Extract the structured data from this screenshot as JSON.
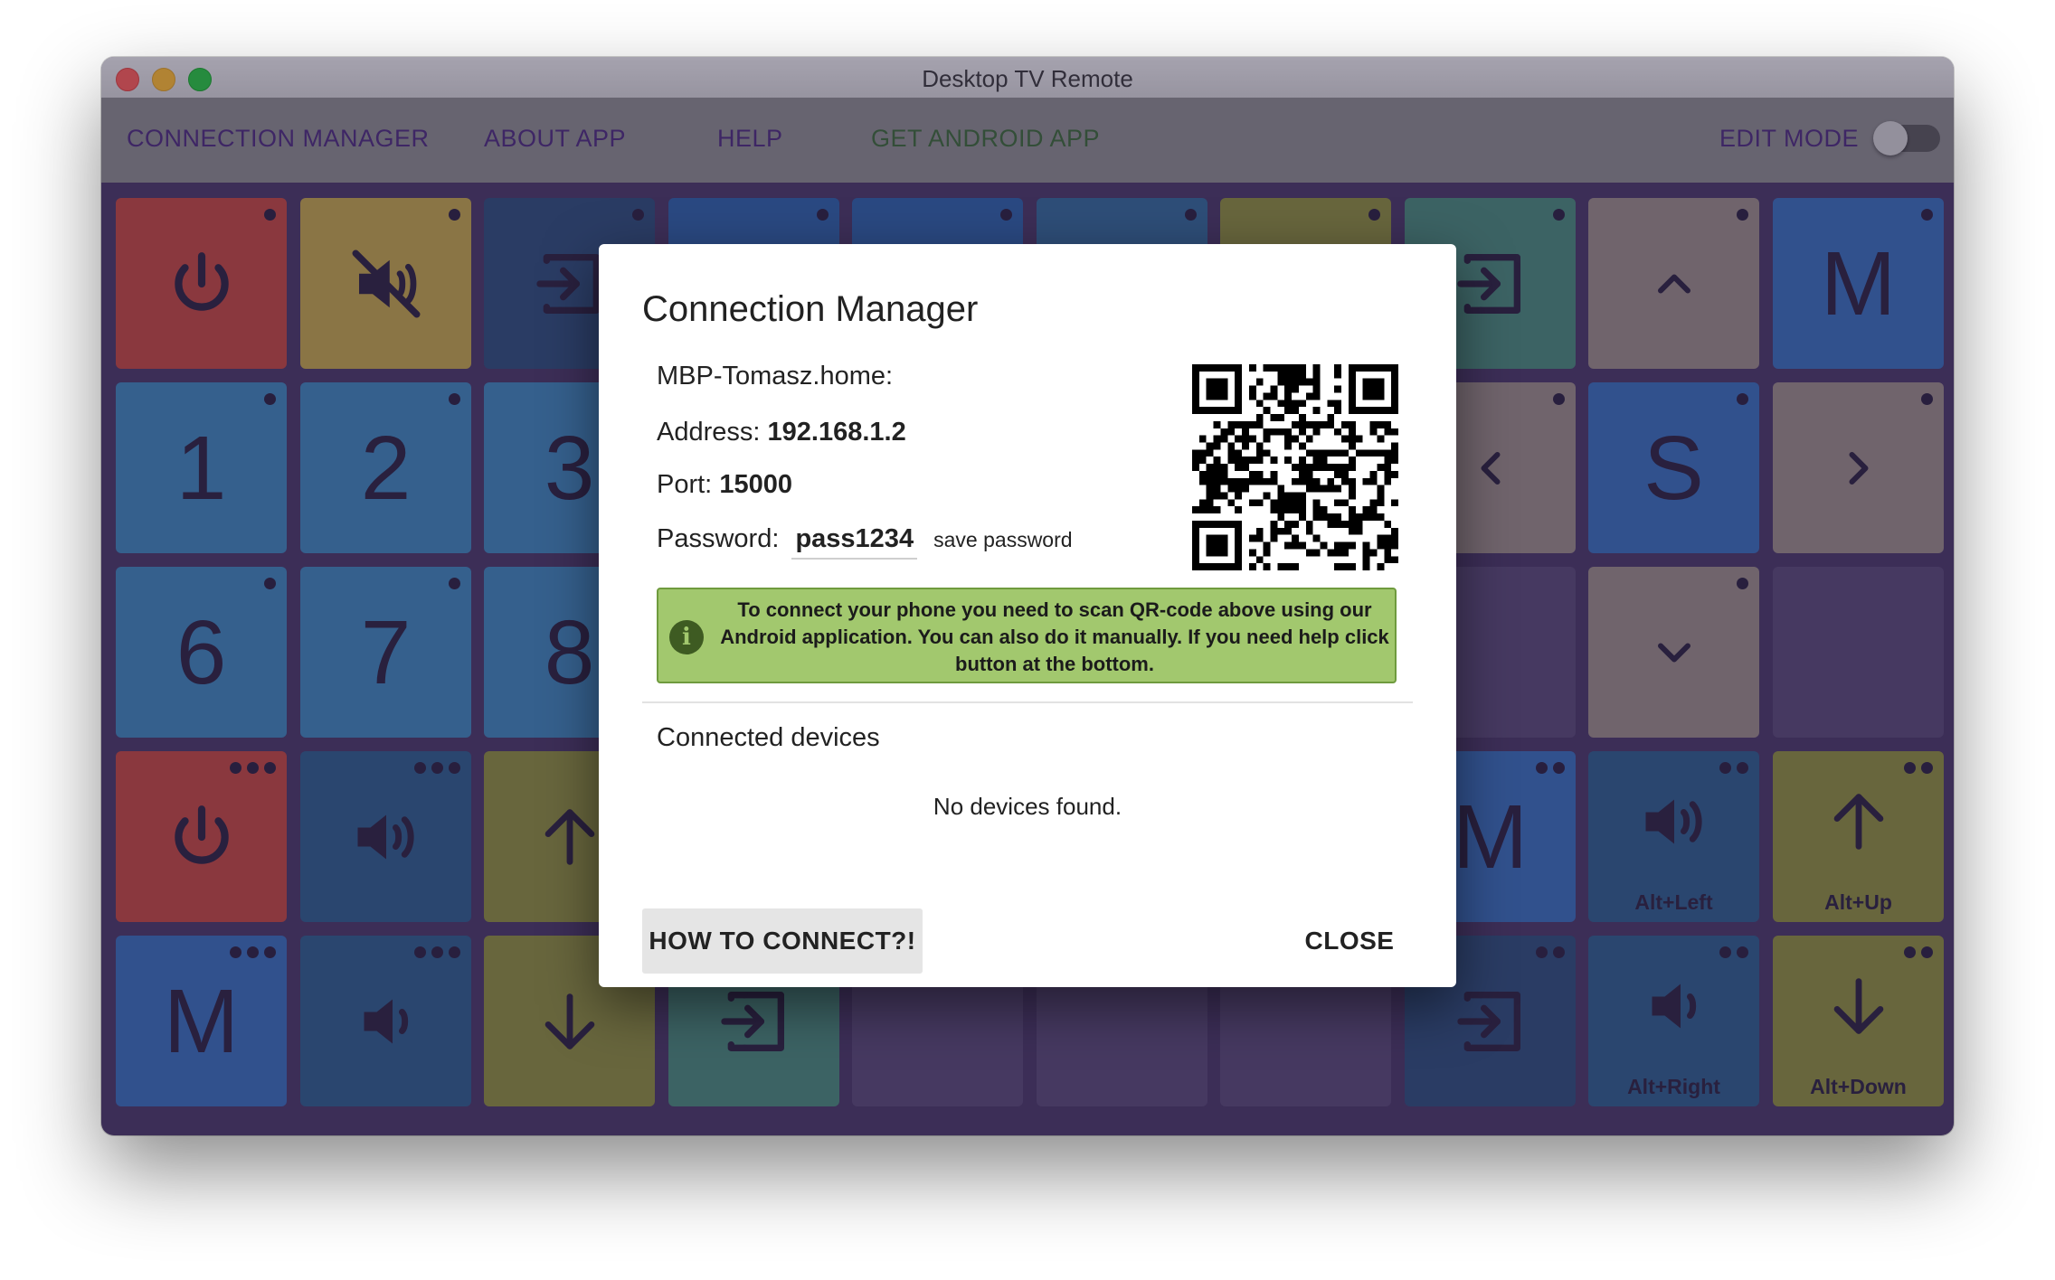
{
  "window": {
    "title": "Desktop TV Remote"
  },
  "nav": {
    "connection_manager": "CONNECTION MANAGER",
    "about_app": "ABOUT APP",
    "help": "HELP",
    "get_android_app": "GET ANDROID APP",
    "edit_mode": "EDIT MODE",
    "edit_mode_on": false
  },
  "colors": {
    "background_grid": "#4a3a66",
    "appbar": "#8c8c8c",
    "nav_purple": "#4d2d7c",
    "nav_green": "#3c6a36",
    "alert_green": "#a2c86e"
  },
  "tiles": [
    {
      "row": 0,
      "col": 0,
      "color": "#c2493f",
      "icon": "power-icon",
      "label": "",
      "caption": "",
      "dots": 1
    },
    {
      "row": 0,
      "col": 1,
      "color": "#c2a64a",
      "icon": "mute-icon",
      "label": "",
      "caption": "",
      "dots": 1
    },
    {
      "row": 0,
      "col": 2,
      "color": "#2f4f7a",
      "icon": "input-icon",
      "label": "",
      "caption": "",
      "dots": 1
    },
    {
      "row": 0,
      "col": 3,
      "color": "#2f63a8",
      "icon": "",
      "label": "",
      "caption": "",
      "dots": 1
    },
    {
      "row": 0,
      "col": 4,
      "color": "#2f63a8",
      "icon": "",
      "label": "",
      "caption": "",
      "dots": 1
    },
    {
      "row": 0,
      "col": 5,
      "color": "#356a99",
      "icon": "",
      "label": "",
      "caption": "",
      "dots": 1
    },
    {
      "row": 0,
      "col": 6,
      "color": "#8e8f3e",
      "icon": "",
      "label": "",
      "caption": "",
      "dots": 1
    },
    {
      "row": 0,
      "col": 7,
      "color": "#4a8a7a",
      "icon": "input-icon",
      "label": "",
      "caption": "",
      "dots": 1
    },
    {
      "row": 0,
      "col": 8,
      "color": "#9a8d86",
      "icon": "chevron-up-icon",
      "label": "",
      "caption": "",
      "dots": 1
    },
    {
      "row": 0,
      "col": 9,
      "color": "#3a6fb8",
      "icon": "",
      "label": "M",
      "caption": "",
      "dots": 1
    },
    {
      "row": 1,
      "col": 0,
      "color": "#3f86b8",
      "icon": "",
      "label": "1",
      "caption": "",
      "dots": 1
    },
    {
      "row": 1,
      "col": 1,
      "color": "#3f86b8",
      "icon": "",
      "label": "2",
      "caption": "",
      "dots": 1
    },
    {
      "row": 1,
      "col": 2,
      "color": "#3f86b8",
      "icon": "",
      "label": "3",
      "caption": "",
      "dots": 0
    },
    {
      "row": 1,
      "col": 7,
      "color": "#9a8d86",
      "icon": "chevron-left-icon",
      "label": "",
      "caption": "",
      "dots": 1
    },
    {
      "row": 1,
      "col": 8,
      "color": "#3a6fb8",
      "icon": "",
      "label": "S",
      "caption": "",
      "dots": 1
    },
    {
      "row": 1,
      "col": 9,
      "color": "#9a8d86",
      "icon": "chevron-right-icon",
      "label": "",
      "caption": "",
      "dots": 1
    },
    {
      "row": 2,
      "col": 0,
      "color": "#3f86b8",
      "icon": "",
      "label": "6",
      "caption": "",
      "dots": 1
    },
    {
      "row": 2,
      "col": 1,
      "color": "#3f86b8",
      "icon": "",
      "label": "7",
      "caption": "",
      "dots": 1
    },
    {
      "row": 2,
      "col": 2,
      "color": "#3f86b8",
      "icon": "",
      "label": "8",
      "caption": "",
      "dots": 0
    },
    {
      "row": 2,
      "col": 7,
      "color": "#5a4a76",
      "icon": "",
      "label": "",
      "caption": "",
      "dots": 0
    },
    {
      "row": 2,
      "col": 8,
      "color": "#9a8d86",
      "icon": "chevron-down-icon",
      "label": "",
      "caption": "",
      "dots": 1
    },
    {
      "row": 2,
      "col": 9,
      "color": "#5a4a76",
      "icon": "",
      "label": "",
      "caption": "",
      "dots": 0
    },
    {
      "row": 3,
      "col": 0,
      "color": "#c2493f",
      "icon": "power-icon",
      "label": "",
      "caption": "",
      "dots": 3
    },
    {
      "row": 3,
      "col": 1,
      "color": "#2f5e8a",
      "icon": "volume-up-icon",
      "label": "",
      "caption": "",
      "dots": 3
    },
    {
      "row": 3,
      "col": 2,
      "color": "#8e8f3e",
      "icon": "arrow-up-icon",
      "label": "",
      "caption": "",
      "dots": 1
    },
    {
      "row": 3,
      "col": 7,
      "color": "#3a6fb8",
      "icon": "",
      "label": "M",
      "caption": "",
      "dots": 2
    },
    {
      "row": 3,
      "col": 8,
      "color": "#2f5e8a",
      "icon": "volume-up-icon",
      "label": "",
      "caption": "Alt+Left",
      "dots": 2
    },
    {
      "row": 3,
      "col": 9,
      "color": "#8e8f3e",
      "icon": "arrow-up-icon",
      "label": "",
      "caption": "Alt+Up",
      "dots": 2
    },
    {
      "row": 4,
      "col": 0,
      "color": "#3a6fb8",
      "icon": "",
      "label": "M",
      "caption": "",
      "dots": 3
    },
    {
      "row": 4,
      "col": 1,
      "color": "#2f5e8a",
      "icon": "volume-down-icon",
      "label": "",
      "caption": "",
      "dots": 3
    },
    {
      "row": 4,
      "col": 2,
      "color": "#8e8f3e",
      "icon": "arrow-down-icon",
      "label": "",
      "caption": "",
      "dots": 1
    },
    {
      "row": 4,
      "col": 3,
      "color": "#4a8a7a",
      "icon": "input-icon",
      "label": "",
      "caption": "",
      "dots": 0
    },
    {
      "row": 4,
      "col": 4,
      "color": "#5a4a76",
      "icon": "",
      "label": "",
      "caption": "",
      "dots": 0
    },
    {
      "row": 4,
      "col": 5,
      "color": "#5a4a76",
      "icon": "",
      "label": "",
      "caption": "",
      "dots": 0
    },
    {
      "row": 4,
      "col": 6,
      "color": "#5a4a76",
      "icon": "",
      "label": "",
      "caption": "",
      "dots": 0
    },
    {
      "row": 4,
      "col": 7,
      "color": "#2f4f7a",
      "icon": "input-icon",
      "label": "",
      "caption": "",
      "dots": 2
    },
    {
      "row": 4,
      "col": 8,
      "color": "#2f5e8a",
      "icon": "volume-down-icon",
      "label": "",
      "caption": "Alt+Right",
      "dots": 2
    },
    {
      "row": 4,
      "col": 9,
      "color": "#8e8f3e",
      "icon": "arrow-down-icon",
      "label": "",
      "caption": "Alt+Down",
      "dots": 2
    }
  ],
  "dialog": {
    "title": "Connection Manager",
    "host": "MBP-Tomasz.home:",
    "address_label": "Address:",
    "address_value": "192.168.1.2",
    "port_label": "Port:",
    "port_value": "15000",
    "password_label": "Password:",
    "password_value": "pass1234",
    "save_password": "save password",
    "qr_icon": "qr-code",
    "info_icon": "i",
    "info_text": "To connect your phone you need to scan QR-code above using our Android application. You can also do it manually. If you need help click button at the bottom.",
    "connected_devices_label": "Connected devices",
    "no_devices": "No devices found.",
    "how_to_connect": "HOW TO CONNECT?!",
    "close": "CLOSE"
  }
}
